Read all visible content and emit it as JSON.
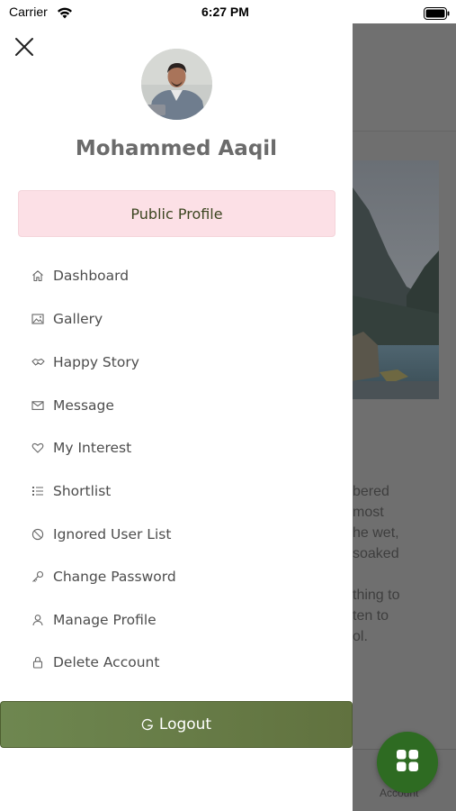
{
  "status_bar": {
    "carrier": "Carrier",
    "time": "6:27 PM"
  },
  "drawer": {
    "user_name": "Mohammed Aaqil",
    "public_profile_label": "Public Profile",
    "menu": [
      {
        "label": "Dashboard",
        "icon": "home-icon"
      },
      {
        "label": "Gallery",
        "icon": "image-icon"
      },
      {
        "label": "Happy Story",
        "icon": "handshake-icon"
      },
      {
        "label": "Message",
        "icon": "mail-icon"
      },
      {
        "label": "My Interest",
        "icon": "heart-icon"
      },
      {
        "label": "Shortlist",
        "icon": "list-icon"
      },
      {
        "label": "Ignored User List",
        "icon": "block-icon"
      },
      {
        "label": "Change Password",
        "icon": "key-icon"
      },
      {
        "label": "Manage Profile",
        "icon": "user-icon"
      },
      {
        "label": "Delete Account",
        "icon": "lock-icon"
      }
    ],
    "logout_label": "Logout"
  },
  "background": {
    "text_lines": [
      "bered",
      "most",
      "he wet,",
      "soaked",
      "",
      "thing to",
      "ten to",
      "ol."
    ],
    "account_label": "Account"
  },
  "colors": {
    "public_profile_bg": "#fce0e6",
    "logout_bg": "#6e8750",
    "fab_bg": "#2e6b22",
    "overlay": "#6f6f6f"
  }
}
